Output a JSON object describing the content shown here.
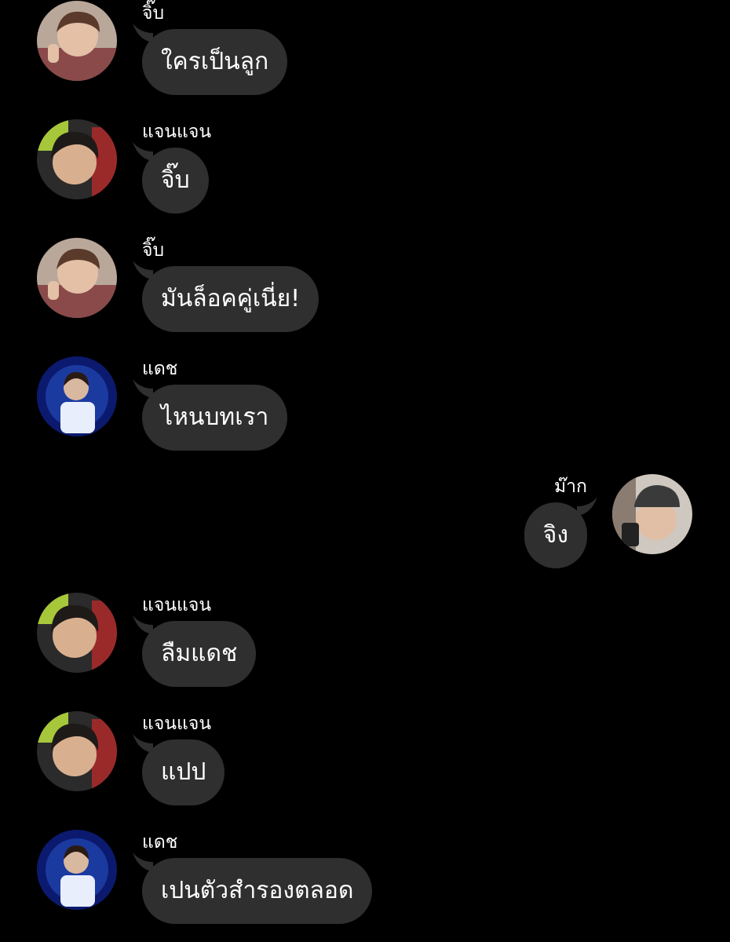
{
  "messages": [
    {
      "sender": "จิ๊บ",
      "avatar": "avatar-jib",
      "text": "ใครเป็นลูก",
      "align": "left"
    },
    {
      "sender": "แจนแจน",
      "avatar": "avatar-janjan",
      "text": "จิ๊บ",
      "align": "left"
    },
    {
      "sender": "จิ๊บ",
      "avatar": "avatar-jib",
      "text": "มันล็อคคู่เนี่ย!",
      "align": "left"
    },
    {
      "sender": "แดช",
      "avatar": "avatar-dash",
      "text": "ไหนบทเรา",
      "align": "left"
    },
    {
      "sender": "ม๊าก",
      "avatar": "avatar-mak",
      "text": "จิง",
      "align": "right"
    },
    {
      "sender": "แจนแจน",
      "avatar": "avatar-janjan",
      "text": "ลืมแดช",
      "align": "left"
    },
    {
      "sender": "แจนแจน",
      "avatar": "avatar-janjan",
      "text": "แปป",
      "align": "left"
    },
    {
      "sender": "แดช",
      "avatar": "avatar-dash",
      "text": "เปนตัวสำรองตลอด",
      "align": "left"
    }
  ],
  "colors": {
    "background": "#000000",
    "bubble": "#2f2f2f",
    "text": "#ffffff"
  }
}
